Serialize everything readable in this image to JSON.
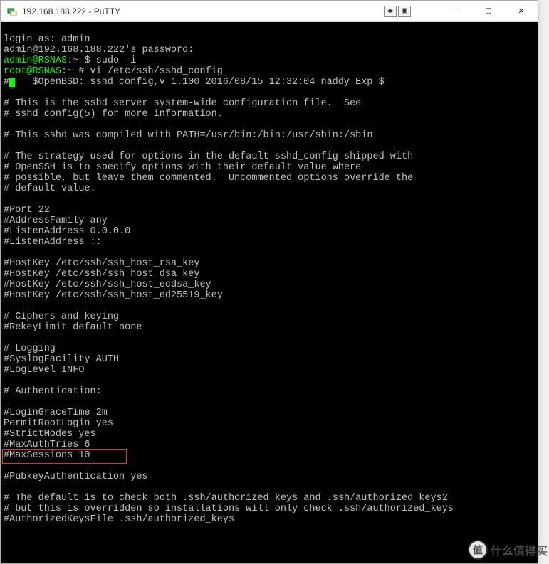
{
  "window": {
    "title": "192.168.188.222 - PuTTY"
  },
  "term": {
    "login_prompt": "login as: ",
    "login_user": "admin",
    "pw_prefix": "admin@192.168.188.222",
    "pw_suffix": "'s password:",
    "prompt1_userhost": "admin@RSNAS",
    "prompt1_sep": ":",
    "prompt1_path": "~",
    "prompt1_cmd": " $ sudo -i",
    "prompt2_userhost": "root@RSNAS",
    "prompt2_sep": ":",
    "prompt2_path": "~",
    "prompt2_cmd": " # vi /etc/ssh/sshd_config",
    "l0": "#",
    "l0b": "   $OpenBSD: sshd_config,v 1.100 2016/08/15 12:32:04 naddy Exp $",
    "l1": "",
    "l2": "# This is the sshd server system-wide configuration file.  See",
    "l3": "# sshd_config(5) for more information.",
    "l4": "",
    "l5": "# This sshd was compiled with PATH=/usr/bin:/bin:/usr/sbin:/sbin",
    "l6": "",
    "l7": "# The strategy used for options in the default sshd_config shipped with",
    "l8": "# OpenSSH is to specify options with their default value where",
    "l9": "# possible, but leave them commented.  Uncommented options override the",
    "l10": "# default value.",
    "l11": "",
    "l12": "#Port 22",
    "l13": "#AddressFamily any",
    "l14": "#ListenAddress 0.0.0.0",
    "l15": "#ListenAddress ::",
    "l16": "",
    "l17": "#HostKey /etc/ssh/ssh_host_rsa_key",
    "l18": "#HostKey /etc/ssh/ssh_host_dsa_key",
    "l19": "#HostKey /etc/ssh/ssh_host_ecdsa_key",
    "l20": "#HostKey /etc/ssh/ssh_host_ed25519_key",
    "l21": "",
    "l22": "# Ciphers and keying",
    "l23": "#RekeyLimit default none",
    "l24": "",
    "l25": "# Logging",
    "l26": "#SyslogFacility AUTH",
    "l27": "#LogLevel INFO",
    "l28": "",
    "l29": "# Authentication:",
    "l30": "",
    "l31": "#LoginGraceTime 2m",
    "l32": "PermitRootLogin yes",
    "l33": "#StrictModes yes",
    "l34": "#MaxAuthTries 6",
    "l35": "#MaxSessions 10",
    "l36": "",
    "l37": "#PubkeyAuthentication yes",
    "l38": "",
    "l39": "# The default is to check both .ssh/authorized_keys and .ssh/authorized_keys2",
    "l40": "# but this is overridden so installations will only check .ssh/authorized_keys",
    "l41": "#AuthorizedKeysFile .ssh/authorized_keys"
  },
  "watermark": {
    "badge": "值",
    "text": "什么值得买"
  }
}
